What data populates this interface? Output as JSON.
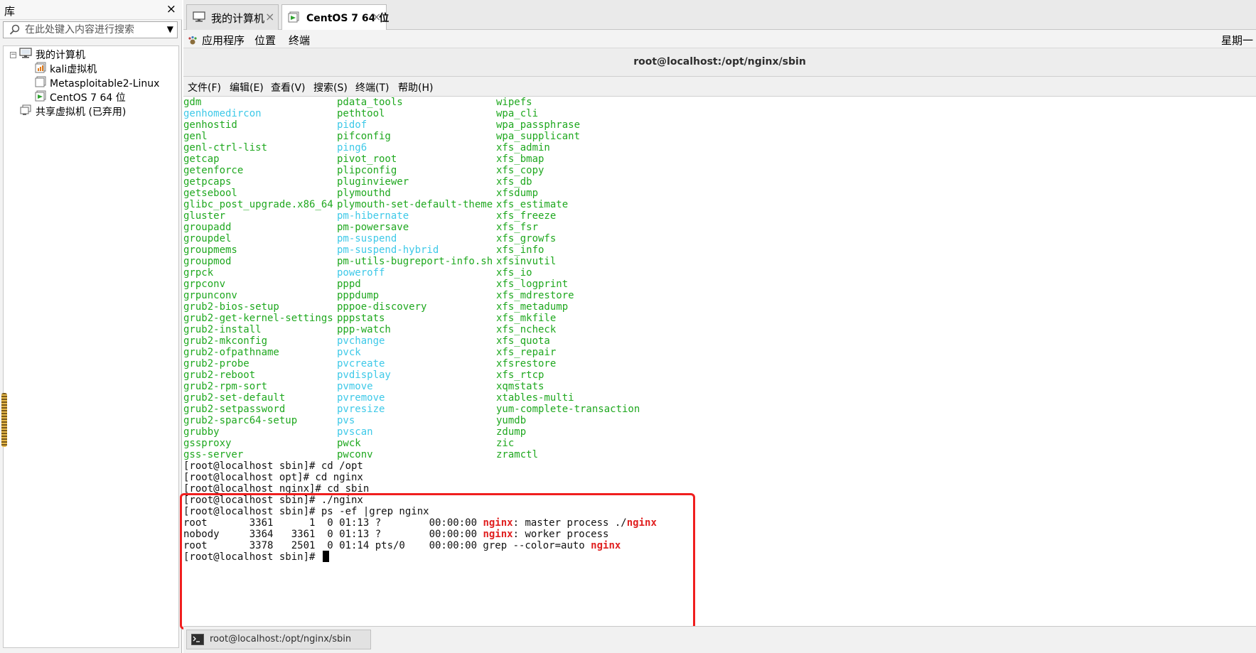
{
  "library": {
    "title": "库",
    "close": "×",
    "search_placeholder": "在此处键入内容进行搜索",
    "tree": {
      "root_label": "我的计算机",
      "vms": [
        "kali虚拟机",
        "Metasploitable2-Linux",
        "CentOS 7 64 位"
      ],
      "shared_label": "共享虚拟机 (已弃用)"
    }
  },
  "tabs": [
    {
      "label": "我的计算机",
      "close": "×"
    },
    {
      "label": "CentOS 7 64 位",
      "close": "×"
    }
  ],
  "gnome_bar": {
    "applications": "应用程序",
    "places": "位置",
    "terminal": "终端",
    "clock": "星期一"
  },
  "terminal": {
    "title": "root@localhost:/opt/nginx/sbin",
    "menu": [
      "文件(F)",
      "编辑(E)",
      "查看(V)",
      "搜索(S)",
      "终端(T)",
      "帮助(H)"
    ],
    "columns": [
      [
        {
          "t": "gdm",
          "c": "green"
        },
        {
          "t": "genhomedircon",
          "c": "cyan"
        },
        {
          "t": "genhostid",
          "c": "green"
        },
        {
          "t": "genl",
          "c": "green"
        },
        {
          "t": "genl-ctrl-list",
          "c": "green"
        },
        {
          "t": "getcap",
          "c": "green"
        },
        {
          "t": "getenforce",
          "c": "green"
        },
        {
          "t": "getpcaps",
          "c": "green"
        },
        {
          "t": "getsebool",
          "c": "green"
        },
        {
          "t": "glibc_post_upgrade.x86_64",
          "c": "green"
        },
        {
          "t": "gluster",
          "c": "green"
        },
        {
          "t": "groupadd",
          "c": "green"
        },
        {
          "t": "groupdel",
          "c": "green"
        },
        {
          "t": "groupmems",
          "c": "green"
        },
        {
          "t": "groupmod",
          "c": "green"
        },
        {
          "t": "grpck",
          "c": "green"
        },
        {
          "t": "grpconv",
          "c": "green"
        },
        {
          "t": "grpunconv",
          "c": "green"
        },
        {
          "t": "grub2-bios-setup",
          "c": "green"
        },
        {
          "t": "grub2-get-kernel-settings",
          "c": "green"
        },
        {
          "t": "grub2-install",
          "c": "green"
        },
        {
          "t": "grub2-mkconfig",
          "c": "green"
        },
        {
          "t": "grub2-ofpathname",
          "c": "green"
        },
        {
          "t": "grub2-probe",
          "c": "green"
        },
        {
          "t": "grub2-reboot",
          "c": "green"
        },
        {
          "t": "grub2-rpm-sort",
          "c": "green"
        },
        {
          "t": "grub2-set-default",
          "c": "green"
        },
        {
          "t": "grub2-setpassword",
          "c": "green"
        },
        {
          "t": "grub2-sparc64-setup",
          "c": "green"
        },
        {
          "t": "grubby",
          "c": "green"
        },
        {
          "t": "gssproxy",
          "c": "green"
        },
        {
          "t": "gss-server",
          "c": "green"
        }
      ],
      [
        {
          "t": "pdata_tools",
          "c": "green"
        },
        {
          "t": "pethtool",
          "c": "green"
        },
        {
          "t": "pidof",
          "c": "cyan"
        },
        {
          "t": "pifconfig",
          "c": "green"
        },
        {
          "t": "ping6",
          "c": "cyan"
        },
        {
          "t": "pivot_root",
          "c": "green"
        },
        {
          "t": "plipconfig",
          "c": "green"
        },
        {
          "t": "pluginviewer",
          "c": "green"
        },
        {
          "t": "plymouthd",
          "c": "green"
        },
        {
          "t": "plymouth-set-default-theme",
          "c": "green"
        },
        {
          "t": "pm-hibernate",
          "c": "cyan"
        },
        {
          "t": "pm-powersave",
          "c": "green"
        },
        {
          "t": "pm-suspend",
          "c": "cyan"
        },
        {
          "t": "pm-suspend-hybrid",
          "c": "cyan"
        },
        {
          "t": "pm-utils-bugreport-info.sh",
          "c": "green"
        },
        {
          "t": "poweroff",
          "c": "cyan"
        },
        {
          "t": "pppd",
          "c": "green"
        },
        {
          "t": "pppdump",
          "c": "green"
        },
        {
          "t": "pppoe-discovery",
          "c": "green"
        },
        {
          "t": "pppstats",
          "c": "green"
        },
        {
          "t": "ppp-watch",
          "c": "green"
        },
        {
          "t": "pvchange",
          "c": "cyan"
        },
        {
          "t": "pvck",
          "c": "cyan"
        },
        {
          "t": "pvcreate",
          "c": "cyan"
        },
        {
          "t": "pvdisplay",
          "c": "cyan"
        },
        {
          "t": "pvmove",
          "c": "cyan"
        },
        {
          "t": "pvremove",
          "c": "cyan"
        },
        {
          "t": "pvresize",
          "c": "cyan"
        },
        {
          "t": "pvs",
          "c": "cyan"
        },
        {
          "t": "pvscan",
          "c": "cyan"
        },
        {
          "t": "pwck",
          "c": "green"
        },
        {
          "t": "pwconv",
          "c": "green"
        }
      ],
      [
        {
          "t": "wipefs",
          "c": "green"
        },
        {
          "t": "wpa_cli",
          "c": "green"
        },
        {
          "t": "wpa_passphrase",
          "c": "green"
        },
        {
          "t": "wpa_supplicant",
          "c": "green"
        },
        {
          "t": "xfs_admin",
          "c": "green"
        },
        {
          "t": "xfs_bmap",
          "c": "green"
        },
        {
          "t": "xfs_copy",
          "c": "green"
        },
        {
          "t": "xfs_db",
          "c": "green"
        },
        {
          "t": "xfsdump",
          "c": "green"
        },
        {
          "t": "xfs_estimate",
          "c": "green"
        },
        {
          "t": "xfs_freeze",
          "c": "green"
        },
        {
          "t": "xfs_fsr",
          "c": "green"
        },
        {
          "t": "xfs_growfs",
          "c": "green"
        },
        {
          "t": "xfs_info",
          "c": "green"
        },
        {
          "t": "xfsinvutil",
          "c": "green"
        },
        {
          "t": "xfs_io",
          "c": "green"
        },
        {
          "t": "xfs_logprint",
          "c": "green"
        },
        {
          "t": "xfs_mdrestore",
          "c": "green"
        },
        {
          "t": "xfs_metadump",
          "c": "green"
        },
        {
          "t": "xfs_mkfile",
          "c": "green"
        },
        {
          "t": "xfs_ncheck",
          "c": "green"
        },
        {
          "t": "xfs_quota",
          "c": "green"
        },
        {
          "t": "xfs_repair",
          "c": "green"
        },
        {
          "t": "xfsrestore",
          "c": "green"
        },
        {
          "t": "xfs_rtcp",
          "c": "green"
        },
        {
          "t": "xqmstats",
          "c": "green"
        },
        {
          "t": "xtables-multi",
          "c": "green"
        },
        {
          "t": "yum-complete-transaction",
          "c": "green"
        },
        {
          "t": "yumdb",
          "c": "green"
        },
        {
          "t": "zdump",
          "c": "green"
        },
        {
          "t": "zic",
          "c": "green"
        },
        {
          "t": "zramctl",
          "c": "green"
        }
      ]
    ],
    "session": [
      [
        {
          "t": "[root@localhost sbin]# cd /opt",
          "c": "black"
        }
      ],
      [
        {
          "t": "[root@localhost opt]# cd nginx",
          "c": "black"
        }
      ],
      [
        {
          "t": "[root@localhost nginx]# cd sbin",
          "c": "black"
        }
      ],
      [
        {
          "t": "[root@localhost sbin]# ./nginx",
          "c": "black"
        }
      ],
      [
        {
          "t": "[root@localhost sbin]# ps -ef |grep nginx",
          "c": "black"
        }
      ],
      [
        {
          "t": "root       3361      1  0 01:13 ?        00:00:00 ",
          "c": "black"
        },
        {
          "t": "nginx",
          "c": "red"
        },
        {
          "t": ": master process ./",
          "c": "black"
        },
        {
          "t": "nginx",
          "c": "red"
        }
      ],
      [
        {
          "t": "nobody     3364   3361  0 01:13 ?        00:00:00 ",
          "c": "black"
        },
        {
          "t": "nginx",
          "c": "red"
        },
        {
          "t": ": worker process",
          "c": "black"
        }
      ],
      [
        {
          "t": "root       3378   2501  0 01:14 pts/0    00:00:00 grep --color=auto ",
          "c": "black"
        },
        {
          "t": "nginx",
          "c": "red"
        }
      ],
      [
        {
          "t": "[root@localhost sbin]# ",
          "c": "black"
        }
      ]
    ]
  },
  "taskbar": {
    "item_label": "root@localhost:/opt/nginx/sbin"
  },
  "colors": {
    "green": "#1fa81f",
    "cyan": "#3ec9e8",
    "red": "#e02020",
    "highlight": "#f01e1e"
  },
  "icons": {
    "search": "magnifier-icon",
    "computer": "computer-icon",
    "vm": "vm-icon",
    "shared": "shared-vm-icon",
    "terminal": "terminal-icon"
  }
}
